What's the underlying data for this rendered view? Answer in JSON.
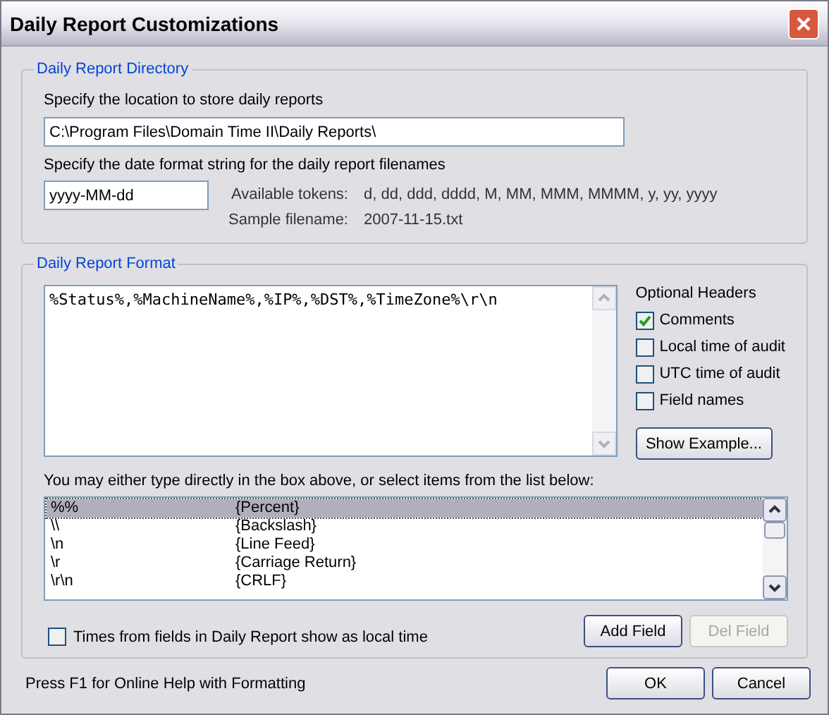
{
  "window": {
    "title": "Daily Report Customizations"
  },
  "directory_group": {
    "title": "Daily Report Directory",
    "location_label": "Specify the location to store daily reports",
    "location_value": "C:\\Program Files\\Domain Time II\\Daily Reports\\",
    "date_label": "Specify the date format string for the daily report filenames",
    "date_value": "yyyy-MM-dd",
    "tokens_label": "Available tokens:",
    "tokens_value": "d, dd, ddd, dddd, M, MM, MMM, MMMM, y, yy, yyyy",
    "sample_label": "Sample filename:",
    "sample_value": "2007-11-15.txt"
  },
  "format_group": {
    "title": "Daily Report Format",
    "format_value": "%Status%,%MachineName%,%IP%,%DST%,%TimeZone%\\r\\n",
    "optional_headers": {
      "title": "Optional Headers",
      "items": [
        {
          "label": "Comments",
          "checked": true
        },
        {
          "label": "Local time of audit",
          "checked": false
        },
        {
          "label": "UTC time of audit",
          "checked": false
        },
        {
          "label": "Field names",
          "checked": false
        }
      ]
    },
    "show_example_button": "Show Example...",
    "hint": "You may either type directly in the box above, or select items from the list below:",
    "fields": [
      {
        "code": "%%",
        "name": "{Percent}",
        "selected": true
      },
      {
        "code": "\\\\",
        "name": "{Backslash}",
        "selected": false
      },
      {
        "code": "\\n",
        "name": "{Line Feed}",
        "selected": false
      },
      {
        "code": "\\r",
        "name": "{Carriage Return}",
        "selected": false
      },
      {
        "code": "\\r\\n",
        "name": "{CRLF}",
        "selected": false
      }
    ],
    "local_time": {
      "label": "Times from fields in Daily Report show as local time",
      "checked": false
    },
    "buttons": [
      {
        "label": "Add Field",
        "disabled": false
      },
      {
        "label": "Del Field",
        "disabled": true
      }
    ]
  },
  "footer": {
    "help": "Press F1 for Online Help with Formatting",
    "buttons": [
      "OK",
      "Cancel"
    ]
  }
}
